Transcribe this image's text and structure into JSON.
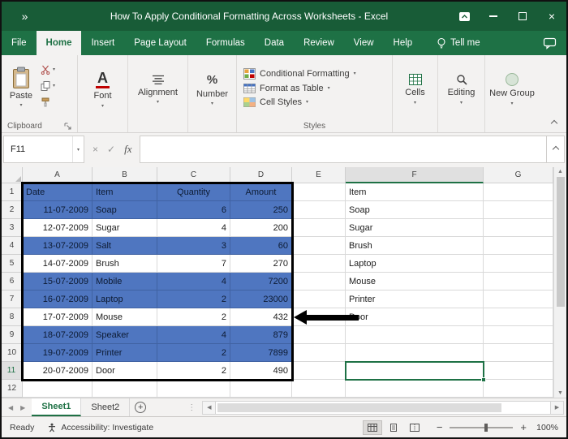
{
  "window": {
    "title": "How To Apply Conditional Formatting Across Worksheets - Excel"
  },
  "ribbon_tabs": [
    "File",
    "Home",
    "Insert",
    "Page Layout",
    "Formulas",
    "Data",
    "Review",
    "View",
    "Help"
  ],
  "tell_me": "Tell me",
  "ribbon": {
    "paste": "Paste",
    "clipboard_group": "Clipboard",
    "font": "Font",
    "alignment": "Alignment",
    "number": "Number",
    "conditional_formatting": "Conditional Formatting",
    "format_as_table": "Format as Table",
    "cell_styles": "Cell Styles",
    "styles_group": "Styles",
    "cells": "Cells",
    "editing": "Editing",
    "new_group": "New Group"
  },
  "formula_bar": {
    "name_box": "F11",
    "fx_label": "fx",
    "formula_value": ""
  },
  "sheet": {
    "active_cell": "F11",
    "active_col": "F",
    "active_row": "11",
    "col_headers": [
      "A",
      "B",
      "C",
      "D",
      "E",
      "F",
      "G"
    ],
    "rows": [
      {
        "n": "1",
        "A": "Date",
        "B": "Item",
        "C": "Quantity",
        "D": "Amount",
        "E": "",
        "F": "Item",
        "G": "",
        "blue": true
      },
      {
        "n": "2",
        "A": "11-07-2009",
        "B": "Soap",
        "C": "6",
        "D": "250",
        "E": "",
        "F": "Soap",
        "G": "",
        "blue": true
      },
      {
        "n": "3",
        "A": "12-07-2009",
        "B": "Sugar",
        "C": "4",
        "D": "200",
        "E": "",
        "F": "Sugar",
        "G": ""
      },
      {
        "n": "4",
        "A": "13-07-2009",
        "B": "Salt",
        "C": "3",
        "D": "60",
        "E": "",
        "F": "Brush",
        "G": "",
        "blue": true
      },
      {
        "n": "5",
        "A": "14-07-2009",
        "B": "Brush",
        "C": "7",
        "D": "270",
        "E": "",
        "F": "Laptop",
        "G": ""
      },
      {
        "n": "6",
        "A": "15-07-2009",
        "B": "Mobile",
        "C": "4",
        "D": "7200",
        "E": "",
        "F": "Mouse",
        "G": "",
        "blue": true
      },
      {
        "n": "7",
        "A": "16-07-2009",
        "B": "Laptop",
        "C": "2",
        "D": "23000",
        "E": "",
        "F": "Printer",
        "G": "",
        "blue": true
      },
      {
        "n": "8",
        "A": "17-07-2009",
        "B": "Mouse",
        "C": "2",
        "D": "432",
        "E": "",
        "F": "Door",
        "G": ""
      },
      {
        "n": "9",
        "A": "18-07-2009",
        "B": "Speaker",
        "C": "4",
        "D": "879",
        "E": "",
        "F": "",
        "G": "",
        "blue": true
      },
      {
        "n": "10",
        "A": "19-07-2009",
        "B": "Printer",
        "C": "2",
        "D": "7899",
        "E": "",
        "F": "",
        "G": "",
        "blue": true
      },
      {
        "n": "11",
        "A": "20-07-2009",
        "B": "Door",
        "C": "2",
        "D": "490",
        "E": "",
        "F": "",
        "G": ""
      },
      {
        "n": "12",
        "A": "",
        "B": "",
        "C": "",
        "D": "",
        "E": "",
        "F": "",
        "G": ""
      }
    ]
  },
  "sheet_tabs": {
    "tabs": [
      "Sheet1",
      "Sheet2"
    ],
    "active": "Sheet1"
  },
  "status_bar": {
    "ready": "Ready",
    "accessibility": "Accessibility: Investigate",
    "zoom_out": "−",
    "zoom_in": "+",
    "zoom": "100%"
  },
  "colors": {
    "title_green": "#185c37",
    "excel_green": "#1e7145",
    "highlight_blue": "#4f76c0"
  }
}
